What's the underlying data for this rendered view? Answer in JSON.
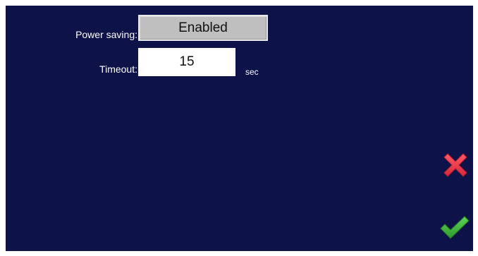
{
  "settings": {
    "power_saving_label": "Power saving:",
    "power_saving_value": "Enabled",
    "timeout_label": "Timeout:",
    "timeout_value": "15",
    "timeout_unit": "sec"
  },
  "actions": {
    "cancel_icon": "close-icon",
    "confirm_icon": "check-icon"
  },
  "colors": {
    "background": "#0d1248",
    "button": "#bfbfbf",
    "cancel": "#e8394a",
    "confirm": "#3fb43c"
  }
}
